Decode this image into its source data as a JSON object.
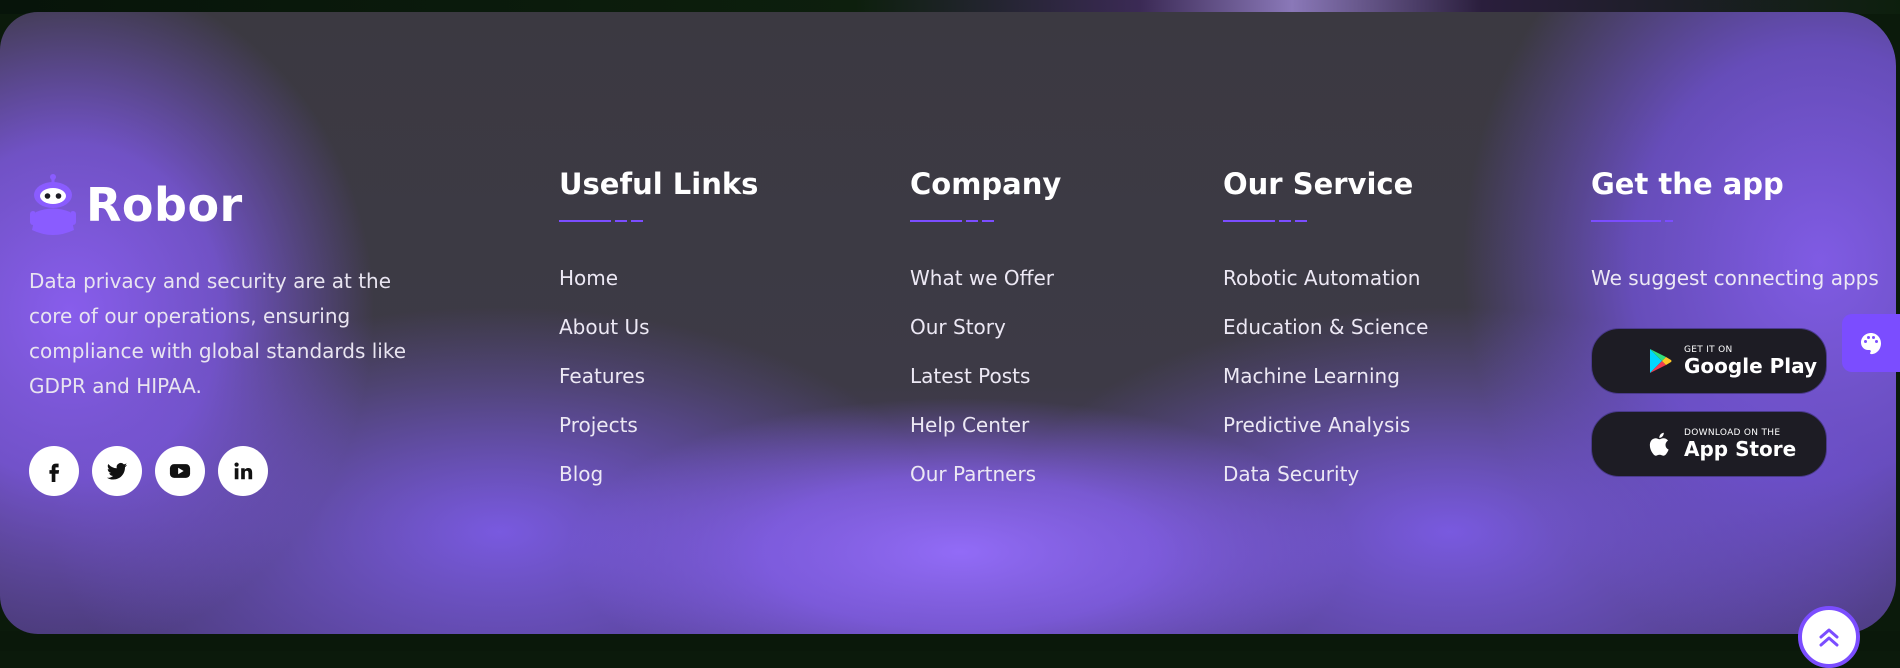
{
  "brand": {
    "name": "Robor"
  },
  "about": {
    "text": "Data privacy and security are at the core of our operations, ensuring compliance with global standards like GDPR and HIPAA."
  },
  "socials": [
    {
      "icon": "facebook-icon"
    },
    {
      "icon": "twitter-icon"
    },
    {
      "icon": "youtube-icon"
    },
    {
      "icon": "linkedin-icon"
    }
  ],
  "useful_links": {
    "title": "Useful Links",
    "items": [
      "Home",
      "About Us",
      "Features",
      "Projects",
      "Blog"
    ]
  },
  "company": {
    "title": "Company",
    "items": [
      "What we Offer",
      "Our Story",
      "Latest Posts",
      "Help Center",
      "Our Partners"
    ]
  },
  "service": {
    "title": "Our Service",
    "items": [
      "Robotic Automation",
      "Education & Science",
      "Machine Learning",
      "Predictive Analysis",
      "Data Security"
    ]
  },
  "app": {
    "title": "Get the app",
    "subtitle": "We suggest connecting apps",
    "google_play": {
      "small": "GET IT ON",
      "big": "Google Play"
    },
    "app_store": {
      "small": "DOWNLOAD ON THE",
      "big": "App Store"
    }
  },
  "colors": {
    "accent": "#7b4dff",
    "button_dark": "#1d1c24",
    "text": "#ece8f4"
  }
}
